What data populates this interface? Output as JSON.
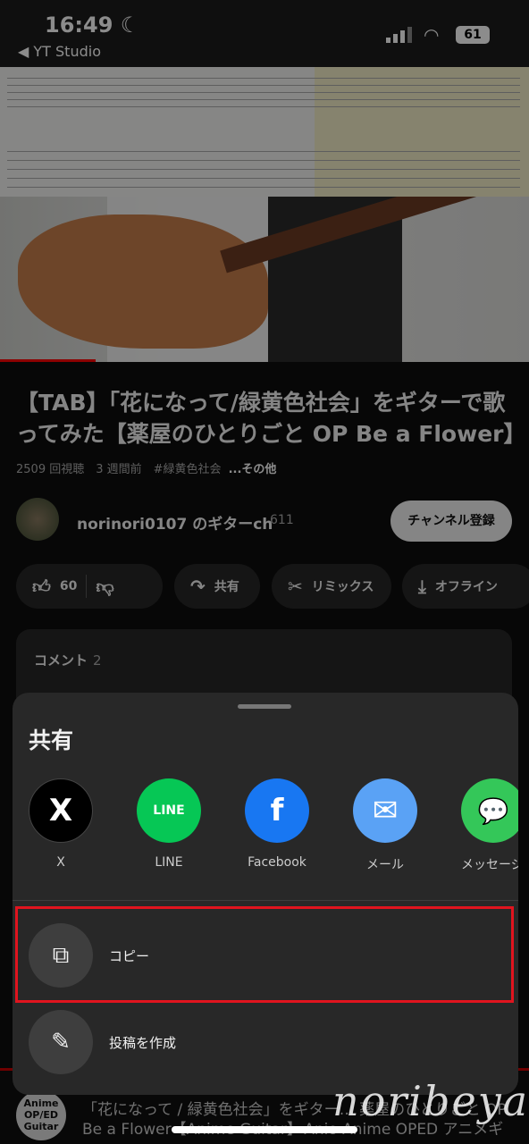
{
  "status": {
    "time": "16:49",
    "back_app": "◀ YT Studio",
    "battery": "61",
    "moon": "☾"
  },
  "video": {
    "progress_fraction": 0.18,
    "title": "【TAB】「花になって/緑黄色社会」をギターで歌ってみた【薬屋のひとりごと OP Be a Flower】",
    "views": "2509 回視聴",
    "age": "3 週間前",
    "hashtag": "#緑黄色社会",
    "more": "...その他"
  },
  "channel": {
    "name": "norinori0107 のギターch",
    "subscribers": "611",
    "subscribe_label": "チャンネル登録"
  },
  "actions": {
    "likes": "60",
    "share": "共有",
    "remix": "リミックス",
    "offline": "オフライン"
  },
  "comments": {
    "label": "コメント",
    "count": "2"
  },
  "next": {
    "thumb": "Anime OP/ED Guitar",
    "text": "「花になって / 緑黄色社会」をギター… 薬屋のひとりごと OP Be a Flower【Anime Guitar】· Anio Anime OPED アニメギターチャンネル【アニオ】·"
  },
  "sheet": {
    "title": "共有",
    "apps": [
      {
        "label": "X",
        "color": "#000000",
        "glyph": "X"
      },
      {
        "label": "LINE",
        "color": "#06c755",
        "glyph": "LINE"
      },
      {
        "label": "Facebook",
        "color": "#1877f2",
        "glyph": "f"
      },
      {
        "label": "メール",
        "color": "#5aa2f5",
        "glyph": "✉"
      },
      {
        "label": "メッセージ",
        "color": "#34c759",
        "glyph": "💬"
      }
    ],
    "copy": "コピー",
    "post": "投稿を作成",
    "highlight_color": "#e0141e"
  },
  "watermark": "noribeya"
}
